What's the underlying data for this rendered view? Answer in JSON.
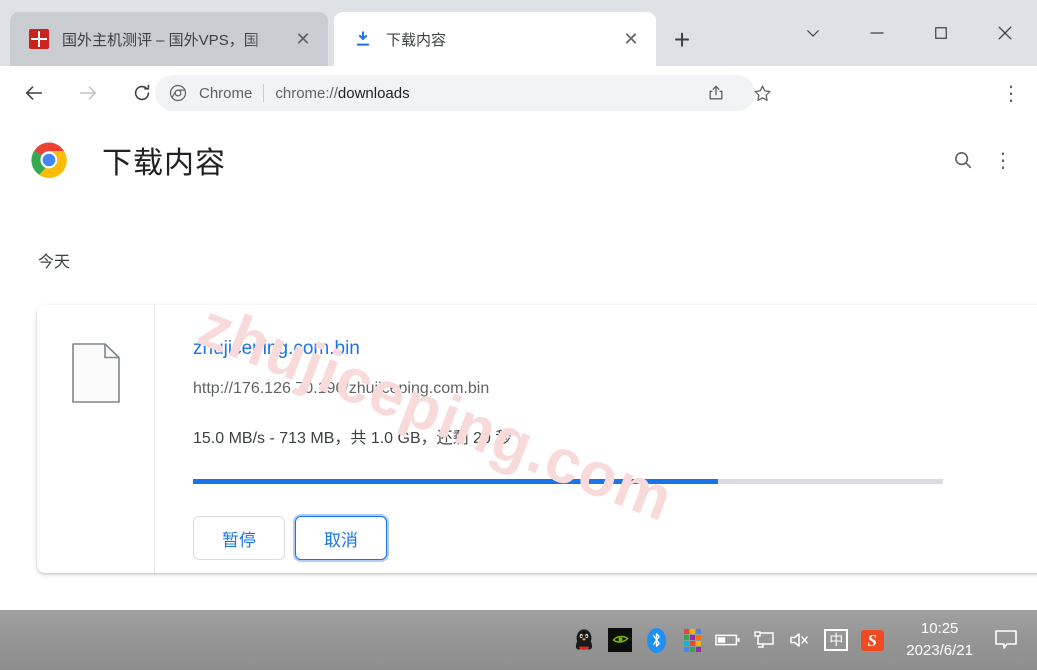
{
  "window": {
    "controls": [
      {
        "name": "tab-search",
        "glyph": "chevron-down"
      },
      {
        "name": "minimize",
        "glyph": "minimize"
      },
      {
        "name": "maximize",
        "glyph": "maximize"
      },
      {
        "name": "close",
        "glyph": "close"
      }
    ]
  },
  "tabs": [
    {
      "title": "国外主机测评 – 国外VPS，国",
      "active": false,
      "favicon": "seal-icon",
      "close_label": "✕"
    },
    {
      "title": "下载内容",
      "active": true,
      "favicon": "download-icon",
      "close_label": "✕"
    }
  ],
  "newtab_label": "+",
  "toolbar": {
    "back_label": "←",
    "forward_label": "→",
    "reload_label": "⟳",
    "omnibox": {
      "scheme_chip": "Chrome",
      "separator": "|",
      "url_prefix": "chrome://",
      "url_path": "downloads",
      "url_full": "chrome://downloads"
    },
    "share_label": "share-icon",
    "bookmark_label": "star-icon",
    "menu_label": "⋮"
  },
  "downloads_page": {
    "title": "下载内容",
    "search_label": "search-icon",
    "more_label": "⋮",
    "section_label": "今天",
    "item": {
      "filename": "zhujiceping.com.bin",
      "url": "http://176.126.70.196/zhujiceping.com.bin",
      "status": "15.0 MB/s - 713 MB，共 1.0 GB，还剩 20 秒",
      "progress_percent": 70,
      "speed": "15.0 MB/s",
      "downloaded": "713 MB",
      "total": "1.0 GB",
      "time_remaining": "还剩 20 秒",
      "buttons": [
        {
          "label": "暂停",
          "name": "pause-button",
          "focused": false
        },
        {
          "label": "取消",
          "name": "cancel-button",
          "focused": true
        }
      ]
    }
  },
  "watermark": "zhujiceping.com",
  "taskbar": {
    "tray_icons": [
      {
        "name": "qq-icon"
      },
      {
        "name": "nvidia-icon"
      },
      {
        "name": "bluetooth-icon"
      },
      {
        "name": "color-grid-icon"
      },
      {
        "name": "battery-icon"
      },
      {
        "name": "network-display-icon"
      },
      {
        "name": "volume-muted-icon"
      },
      {
        "name": "ime-chinese-icon",
        "label": "中"
      },
      {
        "name": "sogou-icon",
        "label": "S"
      }
    ],
    "time": "10:25",
    "date": "2023/6/21",
    "notification_label": "notification-icon"
  },
  "colors": {
    "accent": "#1a73e8",
    "tabstrip": "#dee1e6",
    "inactive_tab": "#c9ccd1",
    "omnibox": "#f1f3f4",
    "progress_track": "#dadce0",
    "watermark": "#f9dada",
    "taskbar": "#949494"
  }
}
